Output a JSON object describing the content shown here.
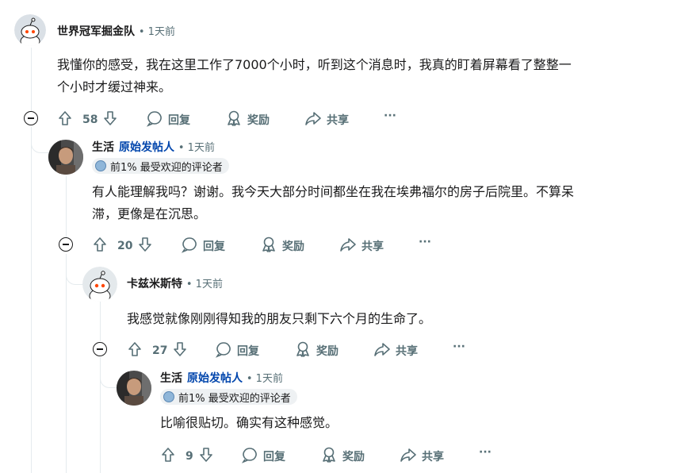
{
  "comments": [
    {
      "author": "世界冠军掘金队",
      "meta": "• 1天前",
      "body_lines": [
        "我懂你的感受，我在这里工作了7000个小时，听到这个消息时，我真的盯着屏幕看了整整一",
        "个小时才缓过神来。"
      ],
      "votes": "58",
      "reply": "回复",
      "award": "奖励",
      "share": "共享",
      "more": "···"
    },
    {
      "author": "生活",
      "op_label": "原始发帖人",
      "meta": "• 1天前",
      "flair": "前1% 最受欢迎的评论者",
      "body_lines": [
        "有人能理解我吗？谢谢。我今天大部分时间都坐在我在埃弗福尔的房子后院里。不算呆",
        "滞，更像是在沉思。"
      ],
      "votes": "20",
      "reply": "回复",
      "award": "奖励",
      "share": "共享",
      "more": "···"
    },
    {
      "author": "卡兹米斯特",
      "meta": "• 1天前",
      "body_lines": [
        "我感觉就像刚刚得知我的朋友只剩下六个月的生命了。"
      ],
      "votes": "27",
      "reply": "回复",
      "award": "奖励",
      "share": "共享",
      "more": "···"
    },
    {
      "author": "生活",
      "op_label": "原始发帖人",
      "meta": "• 1天前",
      "flair": "前1% 最受欢迎的评论者",
      "body_lines": [
        "比喻很贴切。确实有这种感觉。"
      ],
      "votes": "9",
      "reply": "回复",
      "award": "奖励",
      "share": "共享",
      "more": "···"
    }
  ],
  "icons": {
    "upvote": "arrow-up-icon",
    "downvote": "arrow-down-icon",
    "reply": "speech-bubble-icon",
    "award": "award-icon",
    "share": "share-arrow-icon",
    "collapse": "minus-circle-icon",
    "avatar_snoo": "snoo-avatar-icon",
    "avatar_photo": "user-photo-avatar"
  },
  "colors": {
    "op_blue": "#0045ac",
    "meta_gray": "#576f76",
    "thread_line": "#e5ebee",
    "snoo_orange": "#ff4500"
  }
}
